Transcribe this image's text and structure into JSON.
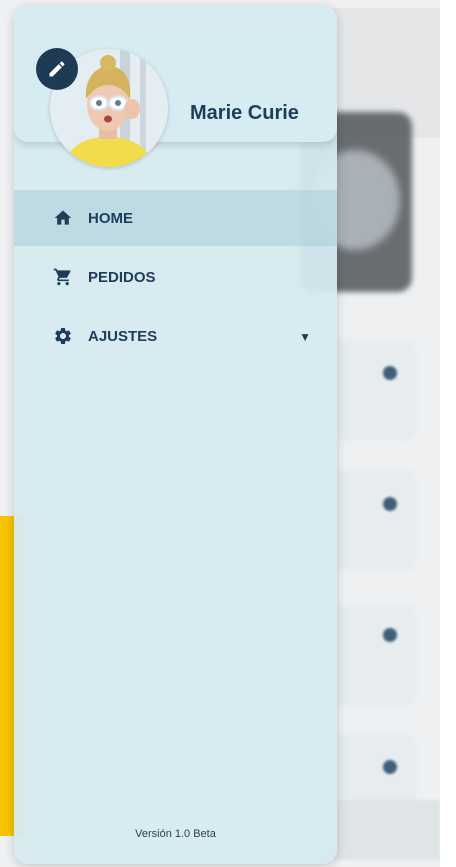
{
  "user": {
    "name": "Marie Curie"
  },
  "nav": {
    "items": [
      {
        "label": "HOME",
        "icon": "home-icon",
        "active": true
      },
      {
        "label": "PEDIDOS",
        "icon": "cart-icon",
        "active": false
      },
      {
        "label": "AJUSTES",
        "icon": "gear-icon",
        "active": false,
        "expandable": true
      }
    ]
  },
  "footer": {
    "version": "Versión 1.0 Beta"
  },
  "colors": {
    "primary_dark": "#1f3a53",
    "drawer_bg": "#d6eaf0",
    "accent_yellow": "#f5c400"
  }
}
